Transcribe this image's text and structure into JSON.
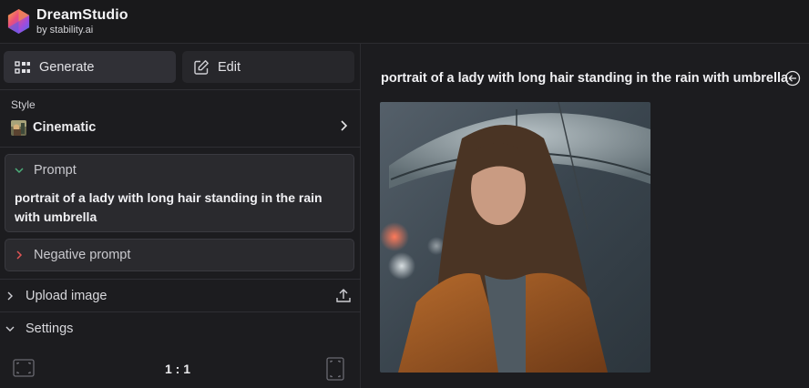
{
  "header": {
    "app_name": "DreamStudio",
    "byline": "by stability.ai"
  },
  "sidebar": {
    "modes": {
      "generate_label": "Generate",
      "edit_label": "Edit",
      "active": "Generate"
    },
    "style": {
      "label": "Style",
      "value": "Cinematic"
    },
    "prompt": {
      "label": "Prompt",
      "text": "portrait of a lady with long hair standing in the rain with umbrella"
    },
    "negative_prompt": {
      "label": "Negative prompt"
    },
    "upload_image": {
      "label": "Upload image"
    },
    "settings": {
      "label": "Settings",
      "aspect_ratio": "1 : 1"
    }
  },
  "main": {
    "title": "portrait of a lady with long hair standing in the rain with umbrella"
  },
  "colors": {
    "background": "#1c1c1f",
    "active_button": "#303036",
    "card": "#2a2a2e",
    "negative_chevron": "#e05555",
    "prompt_chevron": "#4caf7a"
  }
}
